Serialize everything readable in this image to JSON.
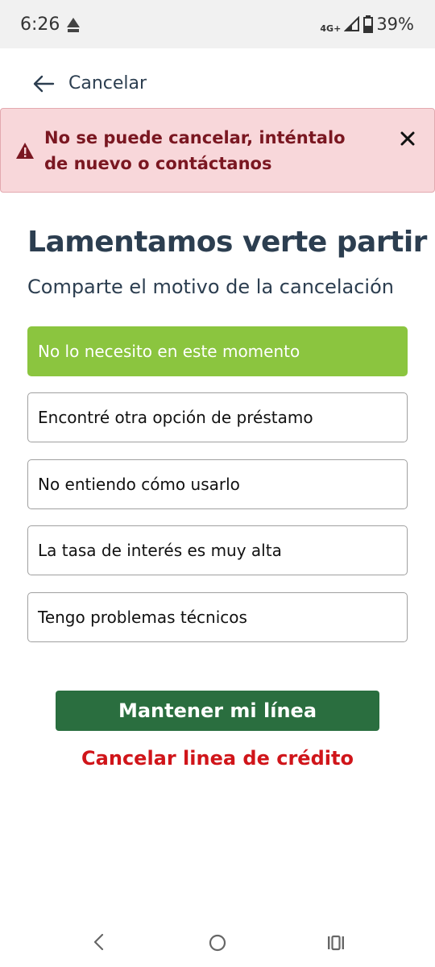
{
  "status_bar": {
    "time": "6:26",
    "network": "4G+",
    "battery": "39%"
  },
  "header": {
    "title": "Cancelar"
  },
  "alert": {
    "message": "No se puede cancelar, inténtalo de nuevo o contáctanos"
  },
  "main": {
    "title": "Lamentamos verte partir",
    "subtitle": "Comparte el motivo de la cancelación",
    "options": [
      {
        "label": "No lo necesito en este momento",
        "selected": true
      },
      {
        "label": "Encontré otra opción de préstamo",
        "selected": false
      },
      {
        "label": "No entiendo cómo usarlo",
        "selected": false
      },
      {
        "label": "La tasa de interés es muy alta",
        "selected": false
      },
      {
        "label": "Tengo problemas técnicos",
        "selected": false
      }
    ]
  },
  "actions": {
    "keep_label": "Mantener mi línea",
    "cancel_label": "Cancelar linea de crédito"
  },
  "colors": {
    "selected_option": "#8bc53f",
    "primary_button": "#2a6e3f",
    "alert_background": "#f8d7da",
    "alert_text": "#7a1721",
    "cancel_link": "#d0151a"
  },
  "icons": {
    "back": "arrow-left-icon",
    "alert": "warning-triangle-icon",
    "close": "close-icon",
    "nav_back": "chevron-left-icon",
    "nav_home": "home-circle-icon",
    "nav_recent": "recent-apps-icon"
  }
}
